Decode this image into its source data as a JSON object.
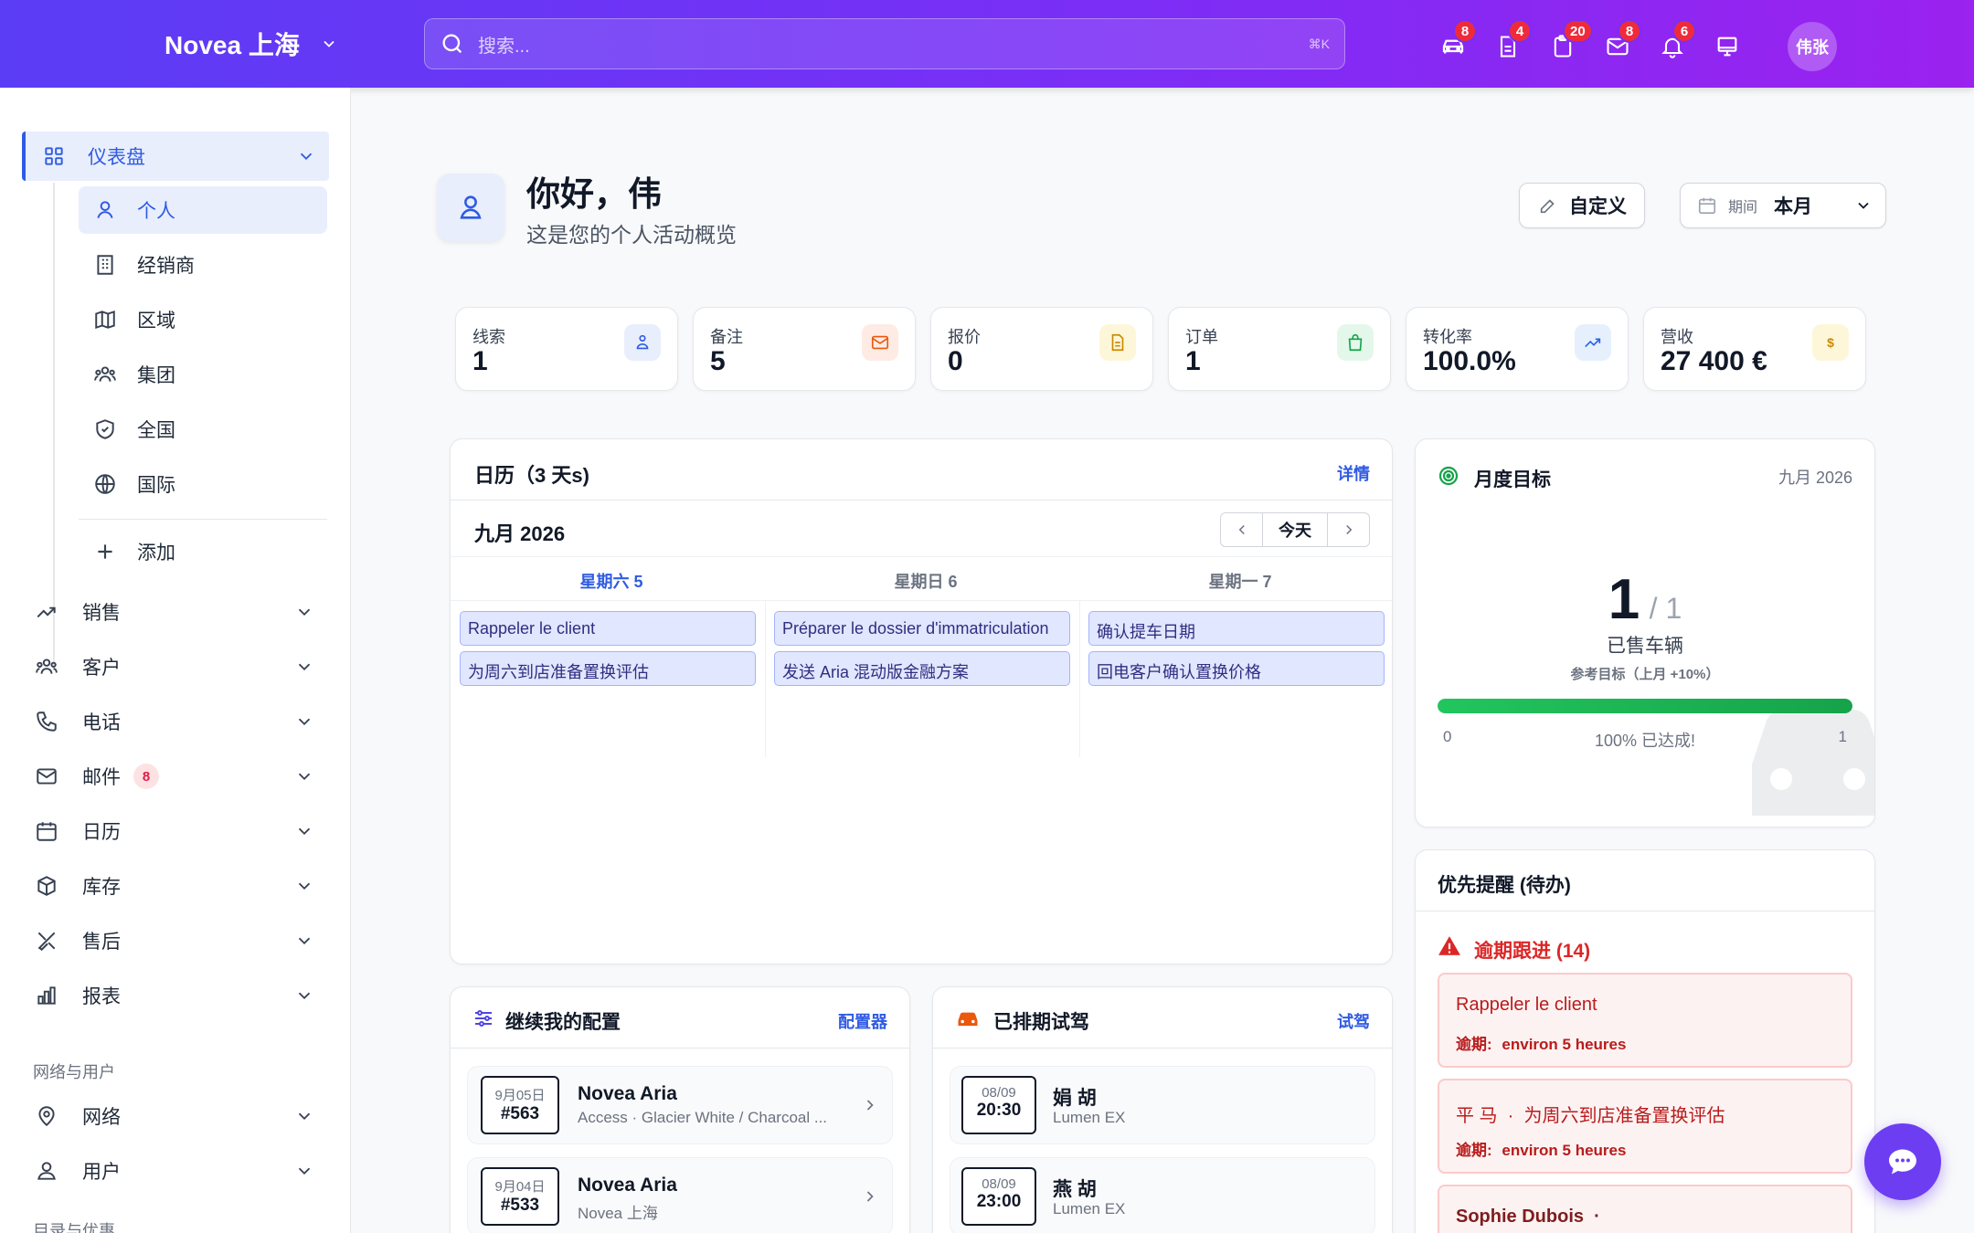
{
  "topbar": {
    "brand": "Novea 上海",
    "search_placeholder": "搜索...",
    "search_shortcut": "⌘K",
    "badges": {
      "car": "8",
      "document": "4",
      "clipboard": "20",
      "mail": "8",
      "bell": "6"
    },
    "avatar": "伟张"
  },
  "sidebar": {
    "dashboard": "仪表盘",
    "sub": [
      "个人",
      "经销商",
      "区域",
      "集团",
      "全国",
      "国际"
    ],
    "add": "添加",
    "items": [
      "销售",
      "客户",
      "电话",
      "邮件",
      "日历",
      "库存",
      "售后",
      "报表"
    ],
    "mail_badge": "8",
    "section_network": "网络与用户",
    "network_items": [
      "网络",
      "用户"
    ],
    "section_catalog": "目录与优惠"
  },
  "header": {
    "greeting": "你好，伟",
    "subtitle": "这是您的个人活动概览",
    "customize": "自定义",
    "period_label": "期间",
    "period_value": "本月"
  },
  "kpis": [
    {
      "label": "线索",
      "value": "1"
    },
    {
      "label": "备注",
      "value": "5"
    },
    {
      "label": "报价",
      "value": "0"
    },
    {
      "label": "订单",
      "value": "1"
    },
    {
      "label": "转化率",
      "value": "100.0%"
    },
    {
      "label": "营收",
      "value": "27 400 €"
    }
  ],
  "calendar": {
    "title": "日历（3 天s)",
    "details": "详情",
    "month": "九月 2026",
    "today": "今天",
    "days": [
      "星期六 5",
      "星期日 6",
      "星期一 7"
    ],
    "events": [
      [
        "Rappeler le client",
        "为周六到店准备置换评估"
      ],
      [
        "Préparer le dossier d'immatriculation",
        "发送 Aria 混动版金融方案"
      ],
      [
        "确认提车日期",
        "回电客户确认置换价格"
      ]
    ]
  },
  "goal": {
    "title": "月度目标",
    "month": "九月 2026",
    "current": "1",
    "target": "/ 1",
    "label": "已售车辆",
    "ref": "参考目标（上月 +10%）",
    "progress": 1.0,
    "min": "0",
    "max": "1",
    "status": "100% 已达成!"
  },
  "priority": {
    "title": "优先提醒 (待办)",
    "overdue_title": "逾期跟进 (14)",
    "items": [
      {
        "title": "Rappeler le client",
        "due_label": "逾期:",
        "due": "environ 5 heures"
      },
      {
        "title": "平 马  ·  为周六到店准备置换评估",
        "due_label": "逾期:",
        "due": "environ 5 heures"
      },
      {
        "title": "Sophie Dubois  ·"
      }
    ]
  },
  "configs": {
    "title": "继续我的配置",
    "link": "配置器",
    "items": [
      {
        "date": "9月05日",
        "num": "#563",
        "name": "Novea Aria",
        "desc": "Access · Glacier White / Charcoal ..."
      },
      {
        "date": "9月04日",
        "num": "#533",
        "name": "Novea Aria",
        "desc": "Novea 上海"
      }
    ]
  },
  "testdrives": {
    "title": "已排期试驾",
    "link": "试驾",
    "items": [
      {
        "date": "08/09",
        "time": "20:30",
        "name": "娟 胡",
        "model": "Lumen EX"
      },
      {
        "date": "08/09",
        "time": "23:00",
        "name": "燕 胡",
        "model": "Lumen EX"
      }
    ]
  },
  "colors": {
    "accent": "#2f5be3",
    "danger": "#dc2626",
    "success": "#16a34a"
  }
}
